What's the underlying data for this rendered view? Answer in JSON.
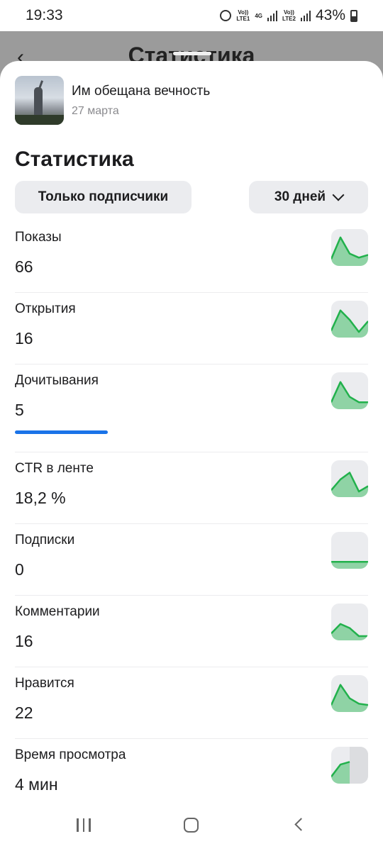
{
  "status_bar": {
    "time": "19:33",
    "sim1": "Vo))\nLTE1",
    "net": "4G",
    "sim2": "Vo))\nLTE2",
    "battery": "43%"
  },
  "background": {
    "title": "Статистика"
  },
  "article": {
    "title": "Им обещана вечность",
    "date": "27 марта"
  },
  "heading": "Статистика",
  "filters": {
    "audience": "Только подписчики",
    "period": "30 дней"
  },
  "colors": {
    "accent_blue": "#1a73e8",
    "spark_line": "#22b14c",
    "spark_fill": "#8fd3a5",
    "chip_bg": "#ebecef"
  },
  "metrics": [
    {
      "label": "Показы",
      "value": "66",
      "spark": [
        0.1,
        0.9,
        0.3,
        0.15,
        0.25
      ]
    },
    {
      "label": "Открытия",
      "value": "16",
      "spark": [
        0.1,
        0.85,
        0.5,
        0.05,
        0.45
      ]
    },
    {
      "label": "Дочитывания",
      "value": "5",
      "spark": [
        0.1,
        0.85,
        0.3,
        0.1,
        0.1
      ],
      "bar": 1
    },
    {
      "label": "CTR в ленте",
      "value": "18,2 %",
      "spark": [
        0.1,
        0.5,
        0.75,
        0.05,
        0.25
      ]
    },
    {
      "label": "Подписки",
      "value": "0",
      "spark": [
        0.1,
        0.1,
        0.1,
        0.1,
        0.1
      ]
    },
    {
      "label": "Комментарии",
      "value": "16",
      "spark": [
        0.1,
        0.45,
        0.3,
        0.0,
        0.0
      ]
    },
    {
      "label": "Нравится",
      "value": "22",
      "spark": [
        0.1,
        0.85,
        0.35,
        0.15,
        0.1
      ]
    },
    {
      "label": "Время просмотра",
      "value": "4 мин",
      "spark": [
        0.1,
        0.55,
        0.65
      ],
      "bar": 1
    }
  ]
}
